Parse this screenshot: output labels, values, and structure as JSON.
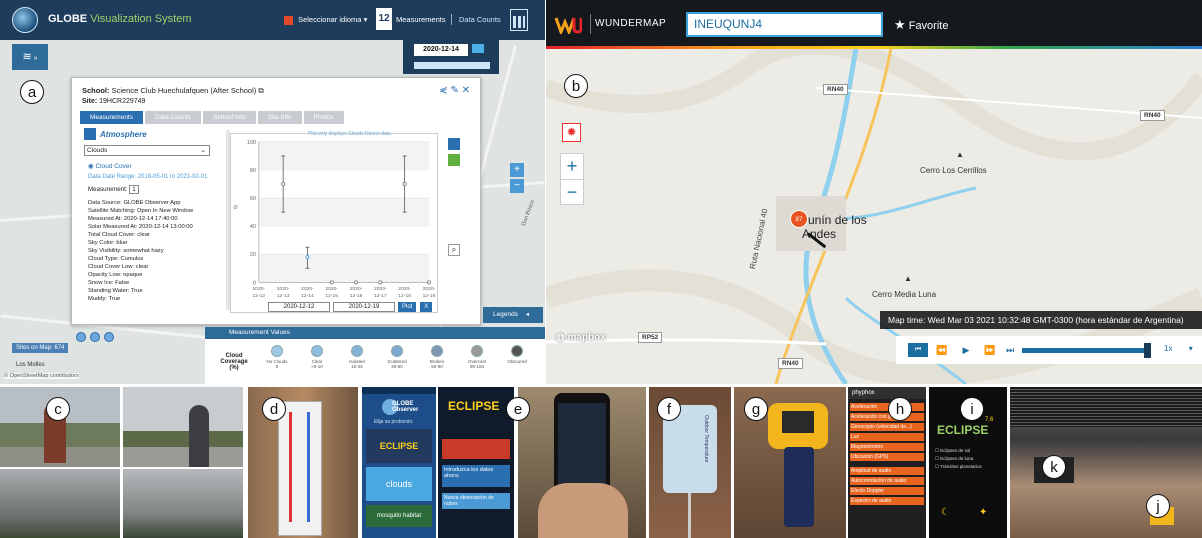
{
  "labels": {
    "a": "a",
    "b": "b",
    "c": "c",
    "d": "d",
    "e": "e",
    "f": "f",
    "g": "g",
    "h": "h",
    "i": "i",
    "j": "j",
    "k": "k"
  },
  "globe": {
    "title_main": "GLOBE",
    "title_accent": "Visualization System",
    "language_label": "Seleccionar idioma",
    "measurements_label": "Measurements",
    "data_counts_label": "Data Counts",
    "date": "2020-12-14",
    "popup": {
      "school_label": "School:",
      "school_name": "Science Club Huechulafquen (After School)",
      "site_label": "Site:",
      "site_id": "19HCR229749",
      "tabs": [
        {
          "label": "Measurements",
          "active": true
        },
        {
          "label": "Data Counts",
          "active": false
        },
        {
          "label": "School Info",
          "active": false
        },
        {
          "label": "Site Info",
          "active": false
        },
        {
          "label": "Photos",
          "active": false
        }
      ],
      "category": "Atmosphere",
      "dropdown_value": "Clouds",
      "radio_label": "Cloud Cover",
      "date_range": "Data Date Range: 2018-05-01 to 2021-02-01",
      "measurement_label": "Measurement:",
      "measurement_value": "1",
      "info_lines": [
        "Data Source: GLOBE Observer App",
        "Satellite Matching: Open In New Window",
        "Measured At: 2020-12-14 17:40:00",
        "Solar Measured At: 2020-12-14 13:00:00",
        "Total Cloud Cover: clear",
        "Sky Color: blue",
        "Sky Visibility: somewhat hazy",
        "Cloud Type: Cumulus",
        "Cloud Cover Low: clear",
        "Opacity Low: opaque",
        "Snow Ice: False",
        "Standing Water: True",
        "Muddy: True"
      ],
      "chart_note": "Plot only displays Clouds Noone data",
      "plot_from": "2020-12-12",
      "plot_to": "2020-12-19",
      "plot_button": "Plot",
      "close_button": "X"
    },
    "legends_label": "Legends",
    "meas_values_label": "Measurement Values",
    "cloud_coverage_label": "Cloud Coverage (%)",
    "coverage_items": [
      {
        "name": "No Clouds",
        "range": "0",
        "color": "#9fc7e6"
      },
      {
        "name": "Clear",
        "range": ">0-10",
        "color": "#8fbde0"
      },
      {
        "name": "Isolated",
        "range": "10-25",
        "color": "#86b3d8"
      },
      {
        "name": "Scattered",
        "range": "25-50",
        "color": "#7ea8cf"
      },
      {
        "name": "Broken",
        "range": "50-90",
        "color": "#7c96b3"
      },
      {
        "name": "Overcast",
        "range": "90-100",
        "color": "#9a9a9a"
      },
      {
        "name": "Obscured",
        "range": "",
        "color": "#555555"
      }
    ],
    "sites_on_map": "Sites on Map: 674",
    "municipality": "Los Molles",
    "attribution": "© OpenStreetMap contributors"
  },
  "chart_data": {
    "type": "scatter",
    "title": "",
    "xlabel": "",
    "ylabel": "",
    "ylim": [
      0,
      100
    ],
    "y_ticks": [
      "0",
      "20",
      "40",
      "60",
      "80",
      "100"
    ],
    "categories": [
      "2020-12-12",
      "2020-12-13",
      "2020-12-14",
      "2020-12-15",
      "2020-12-16",
      "2020-12-17",
      "2020-12-18",
      "2020-12-19"
    ],
    "points": [
      {
        "x": "2020-12-13",
        "y": 70,
        "low": 50,
        "high": 90
      },
      {
        "x": "2020-12-14",
        "y": 18,
        "low": 10,
        "high": 25
      },
      {
        "x": "2020-12-15",
        "y": 0,
        "low": 0,
        "high": 0
      },
      {
        "x": "2020-12-16",
        "y": 0,
        "low": 0,
        "high": 0
      },
      {
        "x": "2020-12-17",
        "y": 0,
        "low": 0,
        "high": 0
      },
      {
        "x": "2020-12-18",
        "y": 70,
        "low": 50,
        "high": 90
      },
      {
        "x": "2020-12-19",
        "y": 0,
        "low": 0,
        "high": 0
      }
    ]
  },
  "wundermap": {
    "brand": "WUNDERMAP",
    "search_value": "INEUQUNJ4",
    "favorite_label": "Favorite",
    "roads": [
      "RN40",
      "RN40",
      "RP52",
      "RN40"
    ],
    "road_name": "Ruta Nacional 40",
    "places": [
      "Cerro Los Cerrillos",
      "Cerro Media Luna"
    ],
    "town": "Junín de los Andes",
    "station_value": "87",
    "map_time": "Map time: Wed Mar 03 2021 10:32:48 GMT-0300 (hora estándar de Argentina)",
    "speed": "1x",
    "mapbox": "mapbox",
    "road_label_right": "Don Bosco"
  },
  "photos": {
    "globe_app_header": "GLOBE Observer",
    "globe_app_sub": "Elija su protocolo:",
    "eclipse_app_title": "ECLIPSE",
    "eclipse_app_line1": "Introduzca los datos ahora:",
    "eclipse_app_line2": "Nueva observación de nubes",
    "clouds_card": "clouds",
    "mosquito_card": "mosquito habitat",
    "sensor_text": "Outdoor Temperature",
    "phyphox_label": "phyphox",
    "phyphox_items": [
      "Aceleración",
      "Aceleración con g",
      "Giroscopio (velocidad de...)",
      "Luz",
      "Magnetómetro",
      "Ubicación (GPS)",
      "Amplitud de audio",
      "Autocorrelación de audio",
      "Efecto Doppler",
      "Espectro de audio"
    ],
    "eclipse_screen_title": "ECLIPSE",
    "eclipse_screen_version": "7.6",
    "eclipse_screen_items": [
      "Eclipses de sol",
      "Eclipses de luna",
      "Tránsitos planetarios"
    ]
  }
}
